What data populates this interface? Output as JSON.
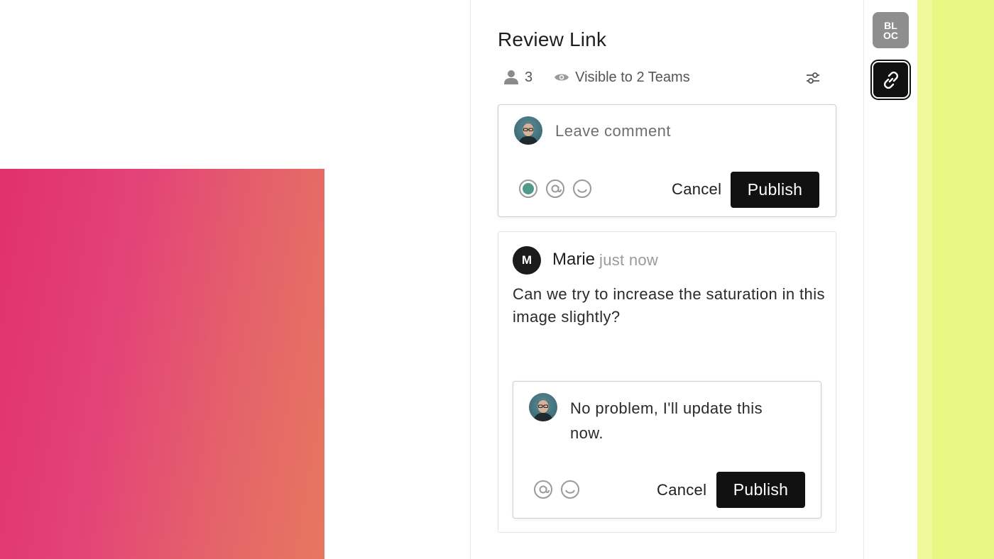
{
  "panel": {
    "title": "Review Link",
    "participants_count": "3",
    "visibility": "Visible to 2 Teams"
  },
  "composer": {
    "placeholder": "Leave comment",
    "cancel_label": "Cancel",
    "publish_label": "Publish",
    "status_color": "#4f9a8b"
  },
  "thread": {
    "author_initial": "M",
    "author": "Marie",
    "time": "just now",
    "body": "Can we try to increase the saturation in this image slightly?",
    "reply": {
      "text": "No problem, I'll update this now.",
      "cancel_label": "Cancel",
      "publish_label": "Publish"
    }
  },
  "rail": {
    "badge_line1": "BL",
    "badge_line2": "OC"
  },
  "icons": [
    "person-icon",
    "eye-icon",
    "filter-icon",
    "status-dot-icon",
    "mention-icon",
    "emoji-icon",
    "link-icon"
  ]
}
